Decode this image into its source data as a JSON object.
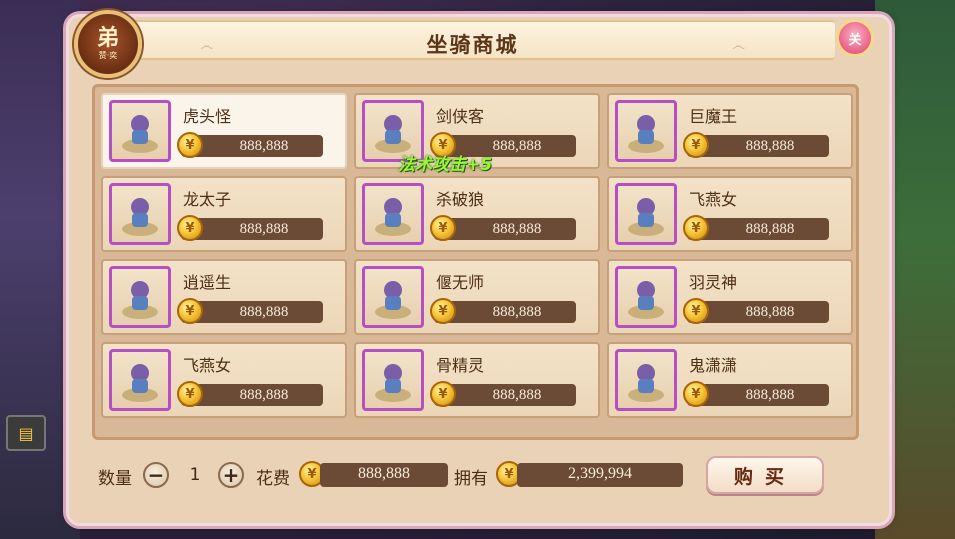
{
  "shop": {
    "title": "坐骑商城",
    "badge_glyph": "弟",
    "badge_sub": "赞·奕",
    "close_glyph": "关"
  },
  "items": [
    {
      "name": "虎头怪",
      "price": "888,888",
      "selected": true
    },
    {
      "name": "剑侠客",
      "price": "888,888"
    },
    {
      "name": "巨魔王",
      "price": "888,888"
    },
    {
      "name": "龙太子",
      "price": "888,888"
    },
    {
      "name": "杀破狼",
      "price": "888,888"
    },
    {
      "name": "飞燕女",
      "price": "888,888"
    },
    {
      "name": "逍遥生",
      "price": "888,888"
    },
    {
      "name": "偃无师",
      "price": "888,888"
    },
    {
      "name": "羽灵神",
      "price": "888,888"
    },
    {
      "name": "飞燕女",
      "price": "888,888"
    },
    {
      "name": "骨精灵",
      "price": "888,888"
    },
    {
      "name": "鬼潇潇",
      "price": "888,888"
    }
  ],
  "floating_text": "法术攻击+5",
  "footer": {
    "quantity_label": "数量",
    "quantity_value": "1",
    "cost_label": "花费",
    "cost_value": "888,888",
    "owned_label": "拥有",
    "owned_value": "2,399,994",
    "buy_label": "购买"
  },
  "colors": {
    "panel": "#e9d2b6",
    "price_bar": "#6b4a36",
    "thumb_border": "#b44fc4",
    "coin": "#f7c637"
  }
}
